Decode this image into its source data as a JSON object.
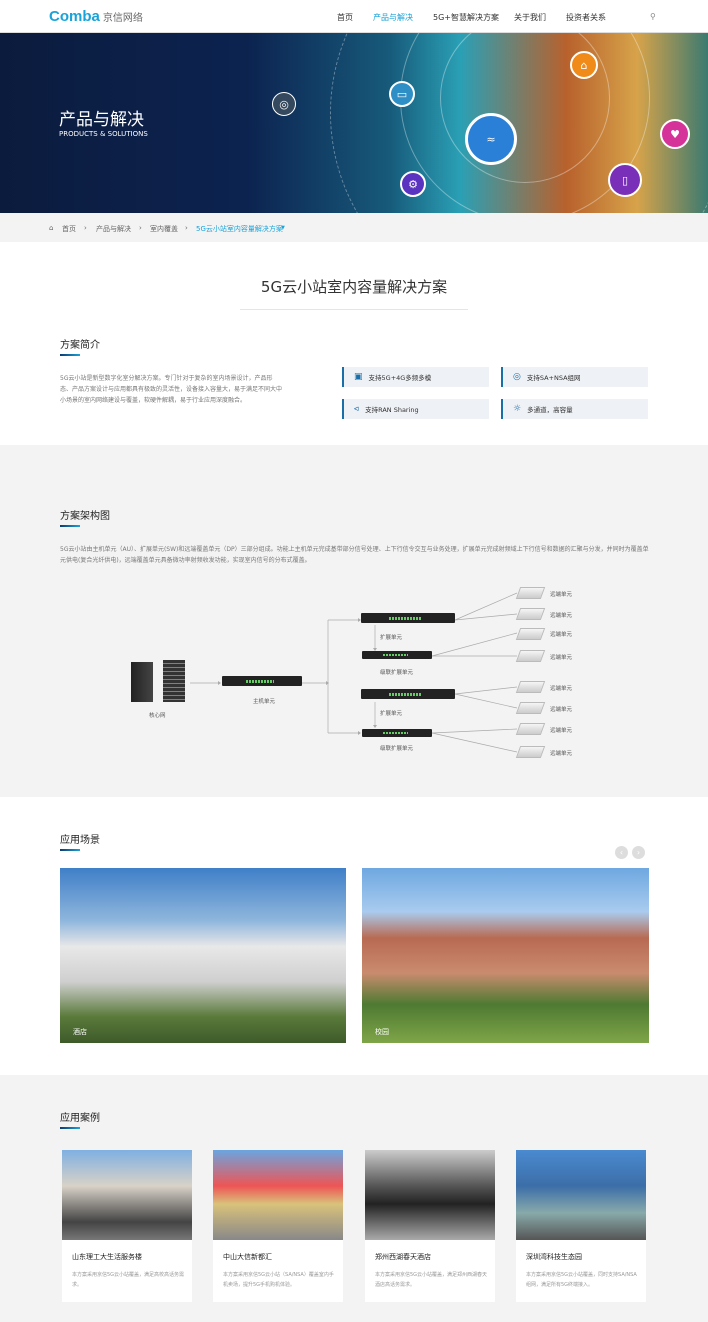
{
  "header": {
    "logo": "Comba",
    "logo_cn": "京信网络",
    "nav": [
      "首页",
      "产品与解决",
      "5G+智慧解决方案",
      "关于我们",
      "投资者关系"
    ],
    "active": "产品与解决",
    "search_icon": "search-icon"
  },
  "banner": {
    "title": "产品与解决",
    "subtitle": "PRODUCTS & SOLUTIONS"
  },
  "breadcrumb": [
    "首页",
    "产品与解决",
    "室内覆盖",
    "5G云小站室内容量解决方案"
  ],
  "page_title": "5G云小站室内容量解决方案",
  "intro": {
    "title": "方案简介",
    "text": "5G云小站是新型数字化室分解决方案。专门针对于复杂的室内场景设计，产品形态、产品方案设计与应用都具有极致的灵活性，设备接入容量大，易于满足不同大中小场景的室内网络建设与覆盖，软硬件解耦，易于行业应用深度融合。",
    "features": [
      {
        "icon": "chip-icon",
        "label": "支持5G+4G多频多模"
      },
      {
        "icon": "globe-icon",
        "label": "支持SA+NSA组网"
      },
      {
        "icon": "share-icon",
        "label": "支持RAN Sharing"
      },
      {
        "icon": "sun-icon",
        "label": "多通道，高容量"
      }
    ]
  },
  "architecture": {
    "title": "方案架构图",
    "text": "5G云小站由主机单元（AU）、扩展单元(SW)和远端覆盖单元（DP）三部分组成。功能上主机单元完成基带部分信号处理、上下行信令交互与业务处理，扩展单元完成射频域上下行信号和数据的汇聚与分发，并同时为覆盖单元供电(复合光纤供电)，远端覆盖单元具备微功率射频收发功能，实现室内信号的分布式覆盖。",
    "labels": {
      "core": "核心网",
      "host": "主机单元",
      "expand": "扩展单元",
      "cascade": "级联扩展单元",
      "remote": "远端单元"
    }
  },
  "scenes": {
    "title": "应用场景",
    "items": [
      "酒店",
      "校园"
    ]
  },
  "cases": {
    "title": "应用案例",
    "items": [
      {
        "title": "山东理工大生活服务楼",
        "desc": "本方案采用京信5G云小站覆盖，满足高校高话务需求。"
      },
      {
        "title": "中山大信新都汇",
        "desc": "本方案采用京信5G云小站（SA/NSA）覆盖室内手机卖场，提升5G手机购机体验。"
      },
      {
        "title": "郑州西湖春天酒店",
        "desc": "本方案采用京信5G云小站覆盖，满足郑州西湖春天酒店高话务需求。"
      },
      {
        "title": "深圳湾科技生态园",
        "desc": "本方案采用京信5G云小站覆盖，同时支持SA/NSA组网，满足所有5G终端接入。"
      }
    ]
  },
  "colors": {
    "accent": "#1aa3d9",
    "dark_blue": "#0d3b6f"
  }
}
